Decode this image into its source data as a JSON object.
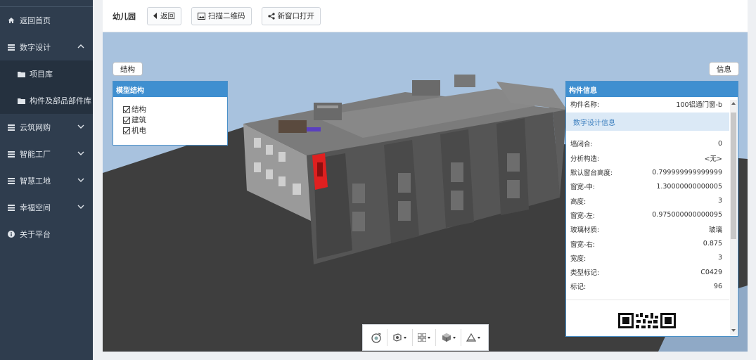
{
  "sidebar": {
    "items": [
      {
        "label": "返回首页",
        "icon": "home-icon"
      },
      {
        "label": "数字设计",
        "icon": "list-icon",
        "expanded": true
      },
      {
        "label": "项目库",
        "icon": "folder-icon"
      },
      {
        "label": "构件及部品部件库",
        "icon": "folder-icon"
      },
      {
        "label": "云筑网购",
        "icon": "list-icon"
      },
      {
        "label": "智能工厂",
        "icon": "list-icon"
      },
      {
        "label": "智慧工地",
        "icon": "list-icon"
      },
      {
        "label": "幸福空间",
        "icon": "list-icon"
      },
      {
        "label": "关于平台",
        "icon": "info-icon"
      }
    ]
  },
  "topbar": {
    "title": "幼儿园",
    "back_label": "返回",
    "scan_label": "扫描二维码",
    "newwin_label": "新窗口打开"
  },
  "viewer": {
    "structure_button": "结构",
    "info_button": "信息",
    "model_panel": {
      "title": "模型结构",
      "items": [
        "结构",
        "建筑",
        "机电"
      ]
    },
    "info_panel": {
      "title": "构件信息",
      "name_label": "构件名称:",
      "name_value": "100铝通门窗-b",
      "section_title": "数字设计信息",
      "rows": [
        {
          "label": "墙闭合:",
          "value": "0"
        },
        {
          "label": "分析构造:",
          "value": "<无>"
        },
        {
          "label": "默认窗台高度:",
          "value": "0.799999999999999"
        },
        {
          "label": "窗宽-中:",
          "value": "1.30000000000005"
        },
        {
          "label": "高度:",
          "value": "3"
        },
        {
          "label": "窗宽-左:",
          "value": "0.975000000000095"
        },
        {
          "label": "玻璃材质:",
          "value": "玻璃"
        },
        {
          "label": "窗宽-右:",
          "value": "0.875"
        },
        {
          "label": "宽度:",
          "value": "3"
        },
        {
          "label": "类型标记:",
          "value": "C0429"
        },
        {
          "label": "标记:",
          "value": "96"
        }
      ]
    },
    "colors": {
      "sky": "#a8c2de",
      "ground": "#3f3f3f",
      "panel_header": "#3f8fd0",
      "highlight": "#e02020"
    }
  }
}
